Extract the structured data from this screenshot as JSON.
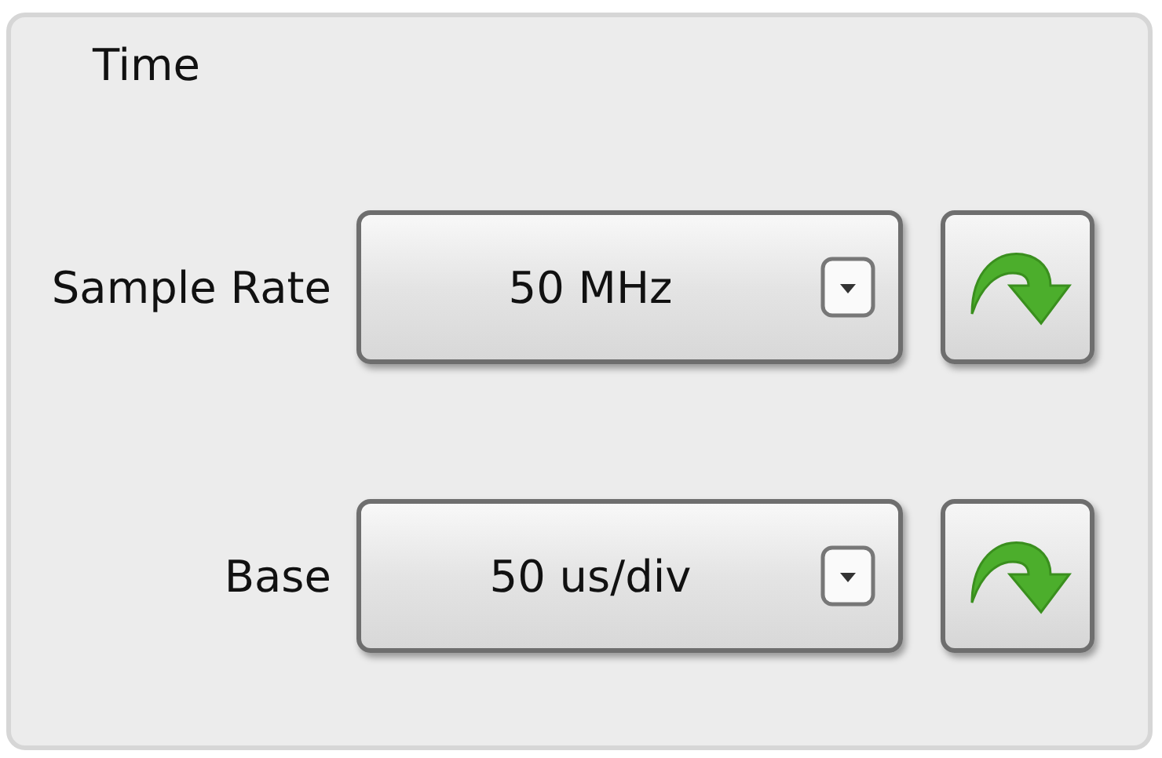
{
  "panel": {
    "title": "Time"
  },
  "rows": [
    {
      "label": "Sample Rate",
      "value": "50 MHz"
    },
    {
      "label": "Base",
      "value": "50 us/div"
    }
  ]
}
